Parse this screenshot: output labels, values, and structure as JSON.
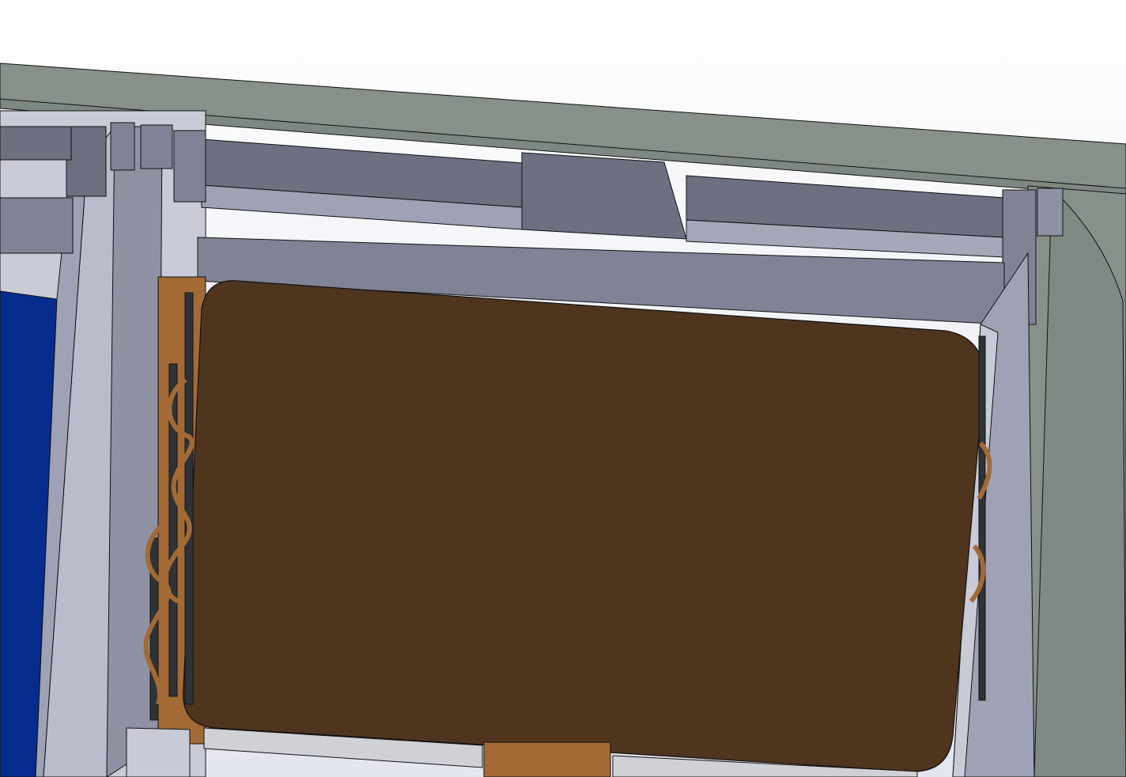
{
  "viewport": {
    "kind": "cad-3d-model-view",
    "background_color": "#eef0f5"
  },
  "colors": {
    "housing": "#87918a",
    "housing_edge": "#5f6862",
    "rail_dark": "#6c7080",
    "rail_mid": "#7f8395",
    "rail_light": "#9ea2b4",
    "frame_light": "#c8cad6",
    "panel_blue": "#062c8e",
    "component_brown": "#4f351e",
    "component_copper": "#a36a36",
    "clip_dark": "#2e3338",
    "bar_light": "#cfd1d6",
    "edge": "#111111"
  },
  "parts": [
    {
      "id": "outer-housing",
      "color": "housing"
    },
    {
      "id": "side-panel-blue",
      "color": "panel_blue"
    },
    {
      "id": "top-rail-left",
      "color": "rail_dark"
    },
    {
      "id": "top-rail-right",
      "color": "rail_dark"
    },
    {
      "id": "center-block",
      "color": "rail_dark"
    },
    {
      "id": "cross-bar",
      "color": "rail_mid"
    },
    {
      "id": "brown-component",
      "color": "component_brown"
    },
    {
      "id": "copper-coils-left",
      "color": "component_copper"
    },
    {
      "id": "copper-coils-right",
      "color": "component_copper"
    },
    {
      "id": "bottom-bar",
      "color": "bar_light"
    }
  ]
}
